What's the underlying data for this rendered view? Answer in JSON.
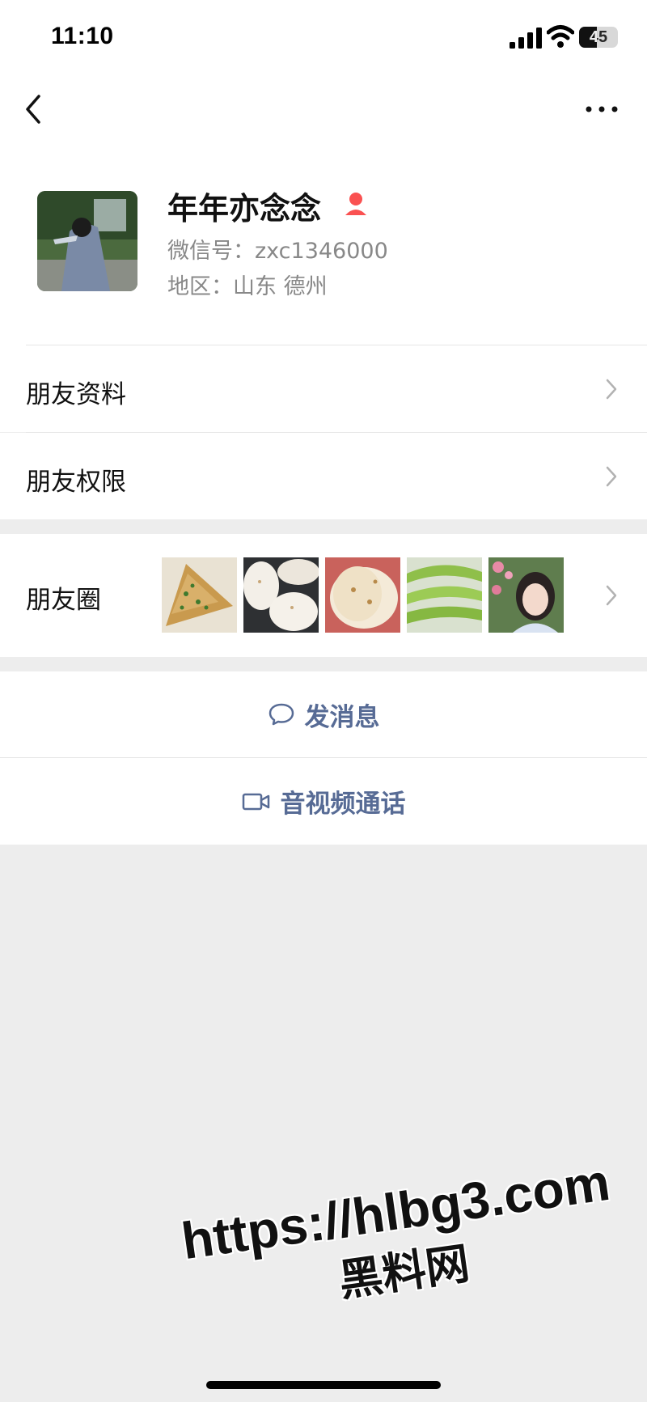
{
  "status_bar": {
    "time": "11:10",
    "battery_level": 45,
    "battery_text": "45",
    "icons": [
      "signal-icon",
      "wifi-icon",
      "battery-icon"
    ]
  },
  "nav": {
    "back_icon": "chevron-left-icon",
    "more_icon": "more-horizontal-icon"
  },
  "profile": {
    "nickname": "年年亦念念",
    "wechat_id": "微信号：zxc1346000",
    "region": "地区：山东 德州",
    "gender_icon": "female-icon",
    "gender_color": "#fa5151"
  },
  "rows": {
    "friend_profile": "朋友资料",
    "friend_permissions": "朋友权限",
    "moments": "朋友圈"
  },
  "moments_thumbnails": [
    "scallion-pancake",
    "flatbreads",
    "flatbread-plate",
    "cucumbers",
    "portrait"
  ],
  "actions": {
    "message": "发消息",
    "message_icon": "chat-bubble-icon",
    "call": "音视频通话",
    "call_icon": "video-camera-icon",
    "accent_color": "#576b95"
  },
  "watermark": {
    "url": "https://hlbg3.com",
    "name": "黑料网"
  }
}
